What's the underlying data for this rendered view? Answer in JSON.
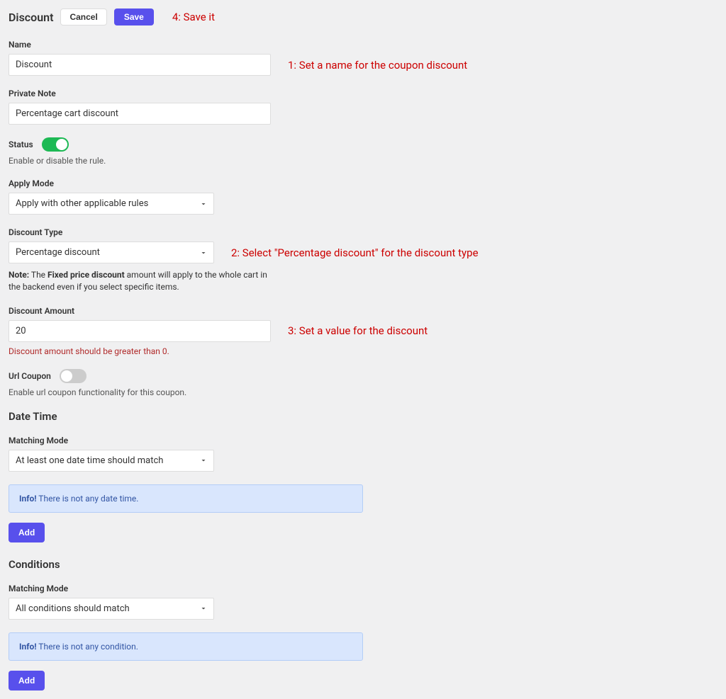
{
  "header": {
    "title": "Discount",
    "cancel": "Cancel",
    "save": "Save"
  },
  "annotations": {
    "a1": "1: Set a name for the coupon discount",
    "a2": "2: Select \"Percentage discount\" for the discount type",
    "a3": "3: Set a value for the discount",
    "a4": "4: Save it"
  },
  "name": {
    "label": "Name",
    "value": "Discount"
  },
  "private_note": {
    "label": "Private Note",
    "value": "Percentage cart discount"
  },
  "status": {
    "label": "Status",
    "hint": "Enable or disable the rule.",
    "enabled": true
  },
  "apply_mode": {
    "label": "Apply Mode",
    "value": "Apply with other applicable rules"
  },
  "discount_type": {
    "label": "Discount Type",
    "value": "Percentage discount",
    "note_prefix": "Note:",
    "note_strong": "Fixed price discount",
    "note_before": " The ",
    "note_after": " amount will apply to the whole cart in the backend even if you select specific items."
  },
  "discount_amount": {
    "label": "Discount Amount",
    "value": "20",
    "hint": "Discount amount should be greater than 0."
  },
  "url_coupon": {
    "label": "Url Coupon",
    "hint": "Enable url coupon functionality for this coupon.",
    "enabled": false
  },
  "datetime": {
    "title": "Date Time",
    "matching_mode_label": "Matching Mode",
    "matching_mode_value": "At least one date time should match",
    "info_strong": "Info!",
    "info_text": " There is not any date time.",
    "add": "Add"
  },
  "conditions": {
    "title": "Conditions",
    "matching_mode_label": "Matching Mode",
    "matching_mode_value": "All conditions should match",
    "info_strong": "Info!",
    "info_text": " There is not any condition.",
    "add": "Add"
  }
}
